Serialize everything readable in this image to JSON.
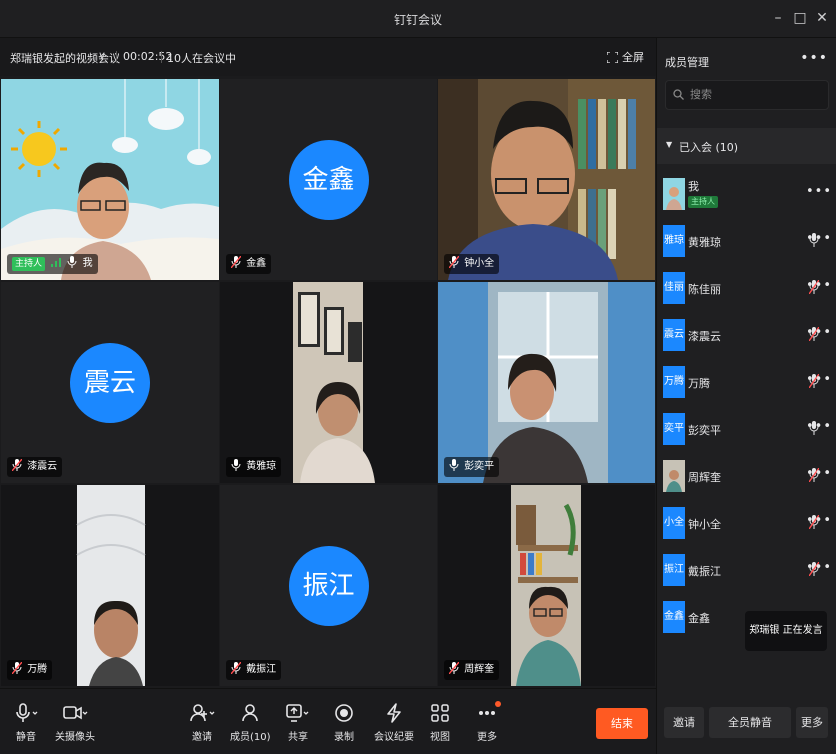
{
  "window": {
    "title": "钉钉会议"
  },
  "meeting": {
    "title": "郑瑞银发起的视频会议",
    "timer": "00:02:52",
    "participant_count": "10人在会议中",
    "fullscreen_label": "全屏"
  },
  "tiles": [
    {
      "name": "我",
      "host_badge": "主持人",
      "avatar_text": ""
    },
    {
      "name": "金鑫",
      "avatar_text": "金鑫"
    },
    {
      "name": "钟小全",
      "avatar_text": ""
    },
    {
      "name": "漆震云",
      "avatar_text": "震云"
    },
    {
      "name": "黄雅琼",
      "avatar_text": ""
    },
    {
      "name": "彭奕平",
      "avatar_text": ""
    },
    {
      "name": "万腾",
      "avatar_text": ""
    },
    {
      "name": "戴振江",
      "avatar_text": "振江"
    },
    {
      "name": "周辉奎",
      "avatar_text": ""
    }
  ],
  "panel": {
    "title": "成员管理",
    "search_placeholder": "搜索",
    "group_label": "已入会 (10)",
    "members": [
      {
        "avatar": "",
        "name": "我",
        "badge": "主持人",
        "mic": "none"
      },
      {
        "avatar": "雅琼",
        "name": "黄雅琼",
        "mic": "on"
      },
      {
        "avatar": "佳丽",
        "name": "陈佳丽",
        "mic": "muted"
      },
      {
        "avatar": "震云",
        "name": "漆震云",
        "mic": "muted"
      },
      {
        "avatar": "万腾",
        "name": "万腾",
        "mic": "muted"
      },
      {
        "avatar": "奕平",
        "name": "彭奕平",
        "mic": "on"
      },
      {
        "avatar": "",
        "name": "周辉奎",
        "mic": "muted"
      },
      {
        "avatar": "小全",
        "name": "钟小全",
        "mic": "muted"
      },
      {
        "avatar": "振江",
        "name": "戴振江",
        "mic": "muted"
      },
      {
        "avatar": "金鑫",
        "name": "金鑫",
        "mic": "muted"
      }
    ],
    "speaking_text": "郑瑞银  正在发言",
    "buttons": {
      "invite": "邀请",
      "mute_all": "全员静音",
      "more": "更多"
    }
  },
  "toolbar": {
    "mute": "静音",
    "camera": "关摄像头",
    "invite": "邀请",
    "members": "成员(10)",
    "share": "共享",
    "record": "录制",
    "minutes": "会议纪要",
    "view": "视图",
    "more": "更多",
    "end": "结束"
  },
  "colors": {
    "accent": "#1b88ff",
    "active_speaker": "#2fbf5a",
    "end_button": "#ff5a22"
  }
}
